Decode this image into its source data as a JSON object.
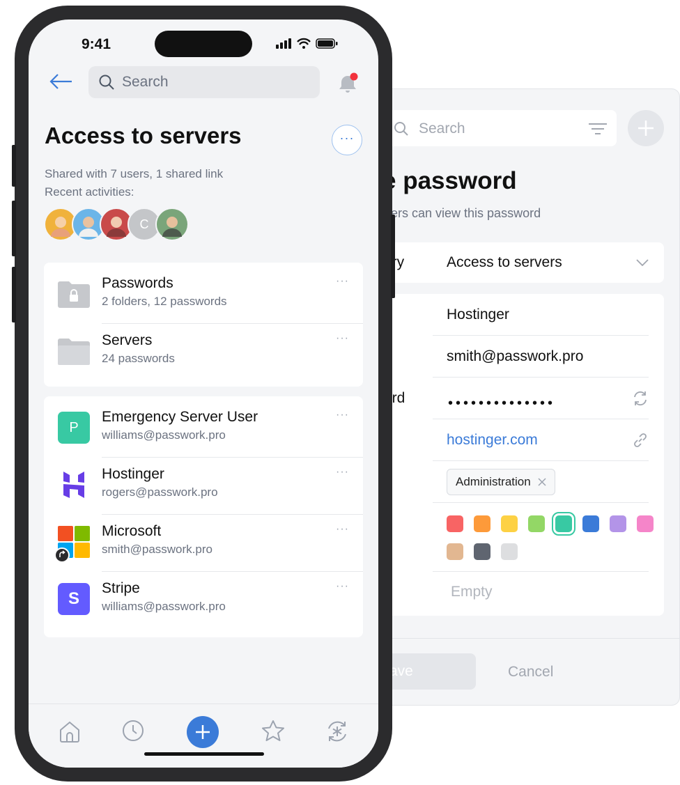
{
  "desktop": {
    "search_placeholder": "Search",
    "title": "e password",
    "subtitle": "ers can view this password",
    "fields": [
      {
        "label": "ory",
        "value": "Access to servers"
      },
      {
        "label": "",
        "value": "Hostinger"
      },
      {
        "label": "",
        "value": "smith@passwork.pro"
      },
      {
        "label": "ord",
        "value": "••••••••••••••"
      },
      {
        "label": "",
        "value": "hostinger.com"
      }
    ],
    "tag": "Administration",
    "colors": [
      "#f86464",
      "#fd9a3a",
      "#fdd144",
      "#93d766",
      "#38c9a3",
      "#3b7bd8",
      "#b394e8",
      "#f585c9",
      "#e2b791",
      "#5f6570",
      "#dddee0"
    ],
    "selected_color": "#38c9a3",
    "notes_placeholder": "Empty",
    "save_label": "Save",
    "cancel_label": "Cancel",
    "save_visible": "ave"
  },
  "phone": {
    "time": "9:41",
    "search_placeholder": "Search",
    "title": "Access to servers",
    "more_glyph": "···",
    "shared_info": "Shared with 7 users, 1 shared link",
    "recent_label": "Recent activities:",
    "avatars": [
      {
        "initial": "",
        "color": "#f0b23c"
      },
      {
        "initial": "",
        "color": "#6bb5e8"
      },
      {
        "initial": "",
        "color": "#c94a4a"
      },
      {
        "initial": "C",
        "color": "#c4c6c9"
      },
      {
        "initial": "",
        "color": "#7aa57a"
      }
    ],
    "folders": [
      {
        "name": "Passwords",
        "sub": "2 folders, 12 passwords"
      },
      {
        "name": "Servers",
        "sub": "24 passwords"
      }
    ],
    "passwords": [
      {
        "name": "Emergency Server User",
        "sub": "williams@passwork.pro",
        "icon_letter": "P"
      },
      {
        "name": "Hostinger",
        "sub": "rogers@passwork.pro"
      },
      {
        "name": "Microsoft",
        "sub": "smith@passwork.pro"
      },
      {
        "name": "Stripe",
        "sub": "williams@passwork.pro",
        "icon_letter": "S"
      }
    ],
    "row_more": "···"
  }
}
